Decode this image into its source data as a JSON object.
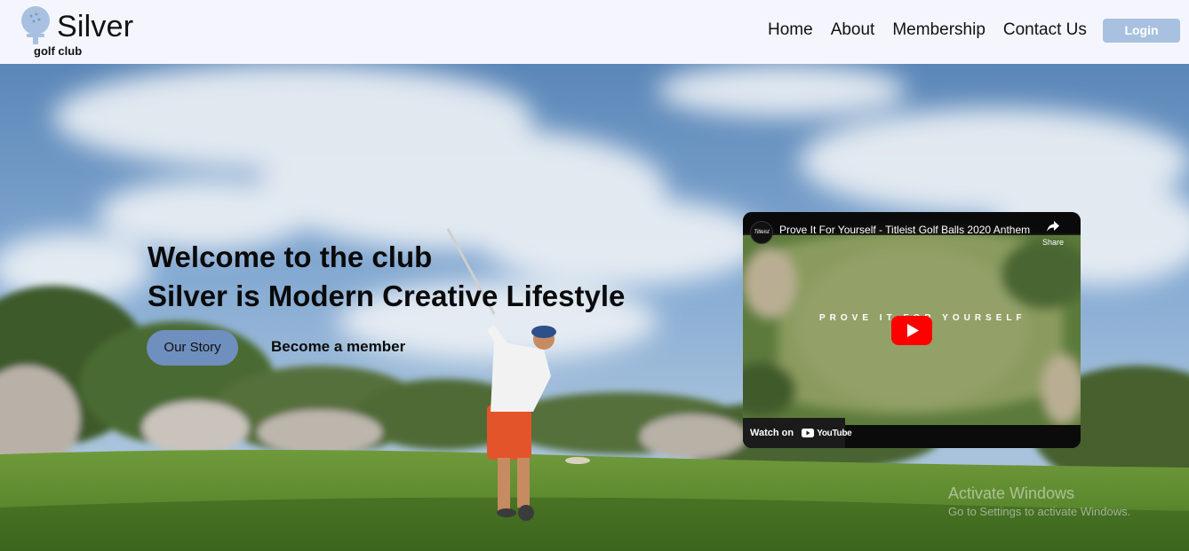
{
  "header": {
    "brand_name": "Silver",
    "brand_sub": "golf club",
    "nav": [
      "Home",
      "About",
      "Membership",
      "Contact Us"
    ],
    "login_label": "Login"
  },
  "hero": {
    "headline_line1": "Welcome to the club",
    "headline_line2": "Silver is Modern Creative Lifestyle",
    "our_story_label": "Our Story",
    "become_member_label": "Become a member"
  },
  "video": {
    "title": "Prove It For Yourself - Titleist Golf Balls 2020 Anthem",
    "channel": "Titleist",
    "share_label": "Share",
    "overlay_text": "PROVE IT FOR YOURSELF",
    "watch_on_label": "Watch on",
    "platform": "YouTube"
  },
  "watermark": {
    "line1": "Activate Windows",
    "line2": "Go to Settings to activate Windows."
  },
  "colors": {
    "header_bg": "#f5f6fd",
    "login_bg": "#a8c1e0",
    "our_story_bg": "#6f8fbe",
    "youtube_red": "#ff0000"
  },
  "icons": [
    "golf-ball-tee-icon",
    "share-icon",
    "play-icon",
    "youtube-logo-icon"
  ]
}
